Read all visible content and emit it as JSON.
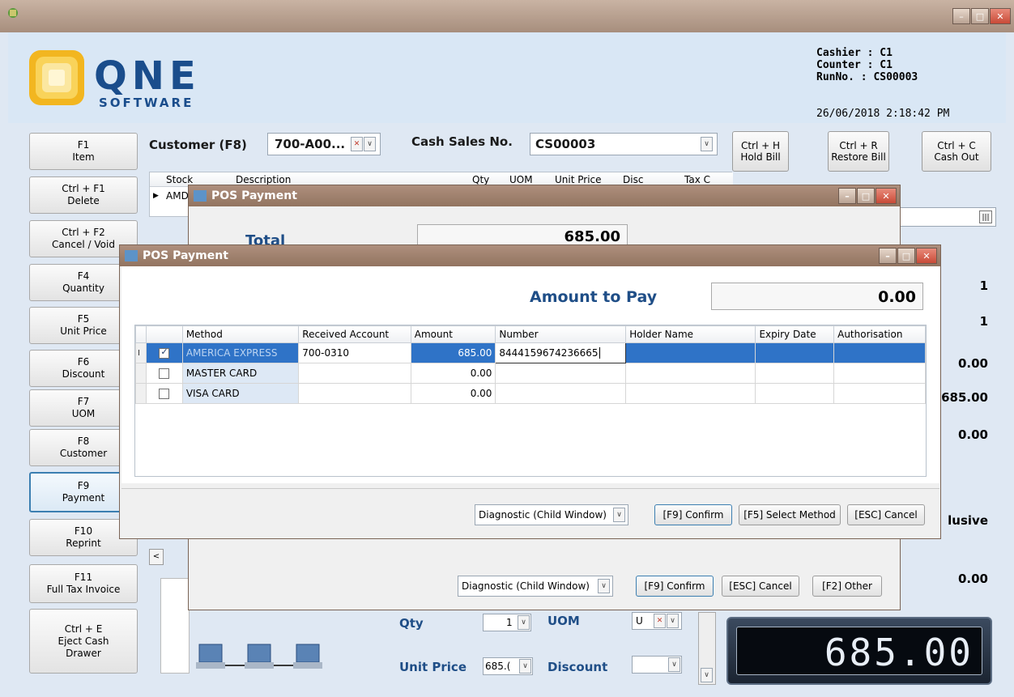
{
  "window": {
    "icon": "app-icon",
    "minimize": "–",
    "maximize": "□",
    "close": "✕"
  },
  "header": {
    "logo_main": "QNE",
    "logo_sub": "SOFTWARE",
    "cashier": "Cashier : C1",
    "counter": "Counter : C1",
    "runno": "RunNo. : CS00003",
    "datetime": "26/06/2018 2:18:42 PM"
  },
  "fkeys": [
    {
      "key": "F1",
      "label": "Item"
    },
    {
      "key": "Ctrl + F1",
      "label": "Delete"
    },
    {
      "key": "Ctrl + F2",
      "label": "Cancel / Void"
    },
    {
      "key": "F4",
      "label": "Quantity"
    },
    {
      "key": "F5",
      "label": "Unit Price"
    },
    {
      "key": "F6",
      "label": "Discount"
    },
    {
      "key": "F7",
      "label": "UOM"
    },
    {
      "key": "F8",
      "label": "Customer"
    },
    {
      "key": "F9",
      "label": "Payment"
    },
    {
      "key": "F10",
      "label": "Reprint"
    },
    {
      "key": "F11",
      "label": "Full Tax Invoice"
    },
    {
      "key": "Ctrl + E",
      "label": "Eject Cash",
      "label2": "Drawer"
    }
  ],
  "top": {
    "customer_label": "Customer (F8)",
    "customer_value": "700-A00...",
    "cash_sales_label": "Cash Sales No.",
    "cash_sales_value": "CS00003",
    "hold": {
      "key": "Ctrl + H",
      "label": "Hold Bill"
    },
    "restore": {
      "key": "Ctrl + R",
      "label": "Restore Bill"
    },
    "cashout": {
      "key": "Ctrl + C",
      "label": "Cash Out"
    }
  },
  "main_grid": {
    "columns": [
      "Stock",
      "Description",
      "Qty",
      "UOM",
      "Unit Price",
      "Disc",
      "Tax C"
    ],
    "row_stock": "AMD"
  },
  "right_values": [
    "1",
    "1",
    "0.00",
    "685.00",
    "0.00",
    "lusive",
    "0.00"
  ],
  "dlg_back": {
    "title": "POS Payment",
    "total_label": "Total",
    "total_value": "685.00",
    "diagnostic": "Diagnostic (Child Window)",
    "confirm": "[F9] Confirm",
    "cancel": "[ESC] Cancel",
    "other": "[F2] Other"
  },
  "dlg_front": {
    "title": "POS Payment",
    "amount_label": "Amount to Pay",
    "amount_value": "0.00",
    "columns": [
      "Method",
      "Received Account",
      "Amount",
      "Number",
      "Holder Name",
      "Expiry Date",
      "Authorisation"
    ],
    "rows": [
      {
        "checked": true,
        "method": "AMERICA EXPRESS",
        "account": "700-0310",
        "amount": "685.00",
        "number": "8444159674236665",
        "holder": "",
        "expiry": "",
        "auth": ""
      },
      {
        "checked": false,
        "method": "MASTER CARD",
        "account": "",
        "amount": "0.00",
        "number": "",
        "holder": "",
        "expiry": "",
        "auth": ""
      },
      {
        "checked": false,
        "method": "VISA CARD",
        "account": "",
        "amount": "0.00",
        "number": "",
        "holder": "",
        "expiry": "",
        "auth": ""
      }
    ],
    "diagnostic": "Diagnostic (Child Window)",
    "confirm": "[F9] Confirm",
    "select_method": "[F5] Select Method",
    "cancel": "[ESC] Cancel"
  },
  "bottom": {
    "qty_label": "Qty",
    "qty_value": "1",
    "uom_label": "UOM",
    "uom_value": "U",
    "unit_price_label": "Unit Price",
    "unit_price_value": "685.(",
    "discount_label": "Discount",
    "display_total": "685.00"
  },
  "colors": {
    "accent": "#1f4e87",
    "titlebar": "#a78e7d",
    "header_bg": "#d9e7f5",
    "selection": "#2f73c7",
    "close": "#c84a37"
  }
}
